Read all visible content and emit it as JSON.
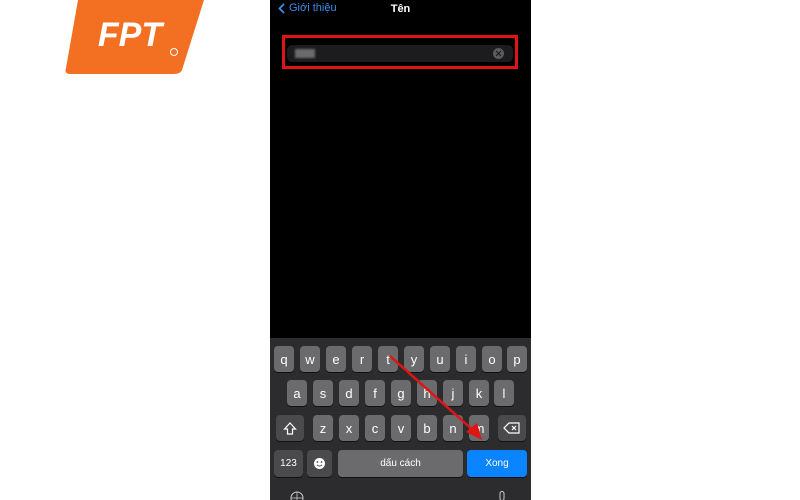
{
  "logo": {
    "text": "FPT",
    "color": "#f36f21"
  },
  "nav": {
    "back_label": "Giới thiệu",
    "title": "Tên"
  },
  "field": {
    "value": ""
  },
  "keyboard": {
    "row1": [
      "q",
      "w",
      "e",
      "r",
      "t",
      "y",
      "u",
      "i",
      "o",
      "p"
    ],
    "row2": [
      "a",
      "s",
      "d",
      "f",
      "g",
      "h",
      "j",
      "k",
      "l"
    ],
    "row3": [
      "z",
      "x",
      "c",
      "v",
      "b",
      "n",
      "m"
    ],
    "num_label": "123",
    "space_label": "dấu cách",
    "done_label": "Xong"
  },
  "colors": {
    "accent": "#0a84ff",
    "highlight": "#e01414"
  },
  "icons": {
    "back": "chevron-left-icon",
    "clear": "clear-icon",
    "shift": "shift-icon",
    "delete": "delete-icon",
    "emoji": "emoji-icon",
    "globe": "globe-icon",
    "mic": "microphone-icon"
  }
}
